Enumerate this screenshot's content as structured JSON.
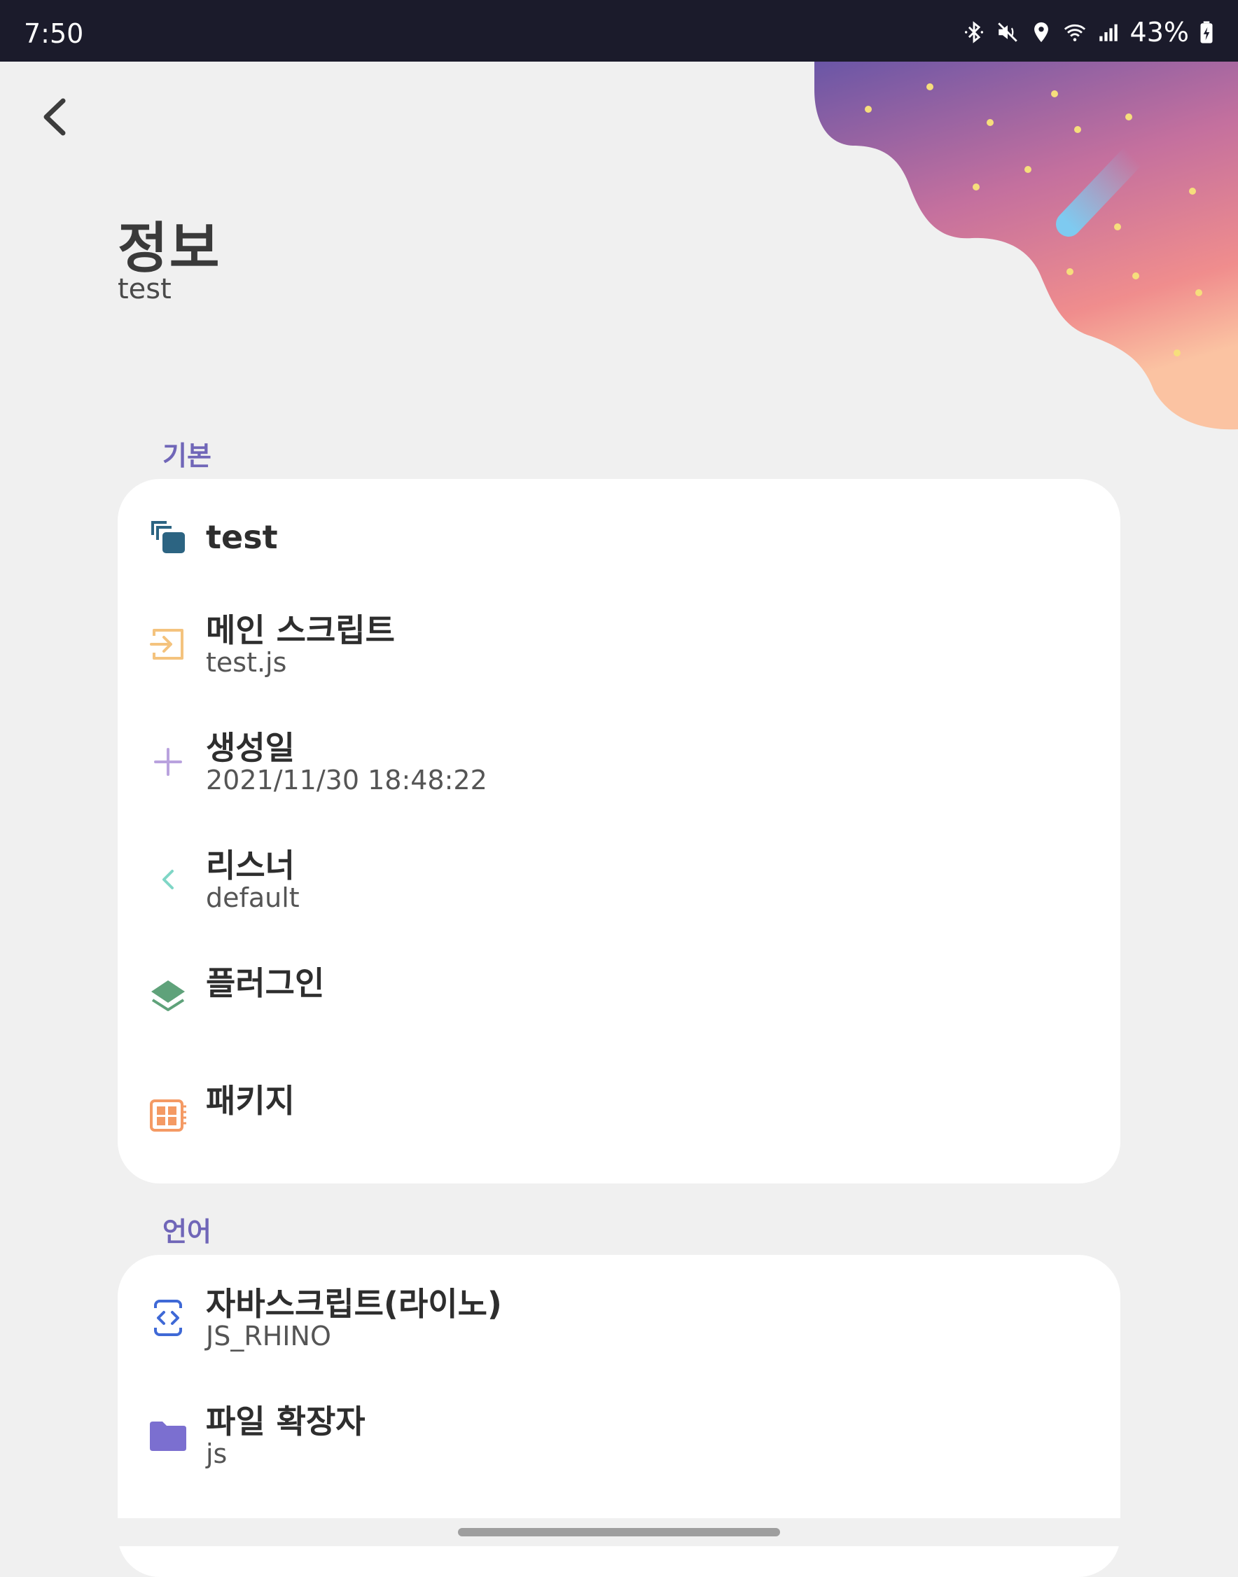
{
  "status_bar": {
    "time": "7:50",
    "battery": "43%"
  },
  "header": {
    "title": "정보",
    "subtitle": "test"
  },
  "sections": {
    "basic": {
      "label": "기본",
      "items": [
        {
          "icon": "project-icon",
          "title": "test",
          "value": ""
        },
        {
          "icon": "main-script-icon",
          "title": "메인 스크립트",
          "value": "test.js"
        },
        {
          "icon": "plus-icon",
          "title": "생성일",
          "value": "2021/11/30 18:48:22"
        },
        {
          "icon": "listener-icon",
          "title": "리스너",
          "value": "default"
        },
        {
          "icon": "plugin-layers-icon",
          "title": "플러그인",
          "value": ""
        },
        {
          "icon": "package-icon",
          "title": "패키지",
          "value": ""
        }
      ]
    },
    "language": {
      "label": "언어",
      "items": [
        {
          "icon": "code-icon",
          "title": "자바스크립트(라이노)",
          "value": "JS_RHINO"
        },
        {
          "icon": "folder-icon",
          "title": "파일 확장자",
          "value": "js"
        }
      ]
    }
  },
  "colors": {
    "accent": "#7066b8",
    "status_bar": "#1b1b2b",
    "background": "#f0f0f0",
    "card": "#ffffff"
  }
}
